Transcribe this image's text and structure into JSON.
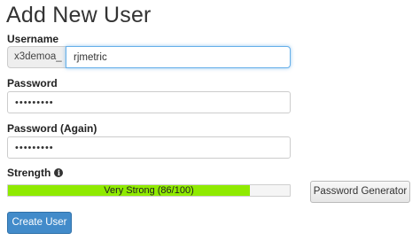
{
  "page": {
    "title": "Add New User"
  },
  "form": {
    "username": {
      "label": "Username",
      "prefix": "x3demoa_",
      "value": "rjmetric"
    },
    "password": {
      "label": "Password",
      "value": "•••••••••"
    },
    "password_again": {
      "label": "Password (Again)",
      "value": "•••••••••"
    },
    "strength": {
      "label": "Strength",
      "info_icon": "info-circle-icon",
      "text": "Very Strong (86/100)",
      "score": 86,
      "max": 100,
      "fill_color": "#8fea00"
    },
    "generator_button": "Password Generator",
    "submit_button": "Create User"
  },
  "colors": {
    "primary": "#428bca",
    "focus": "#66afe9"
  }
}
